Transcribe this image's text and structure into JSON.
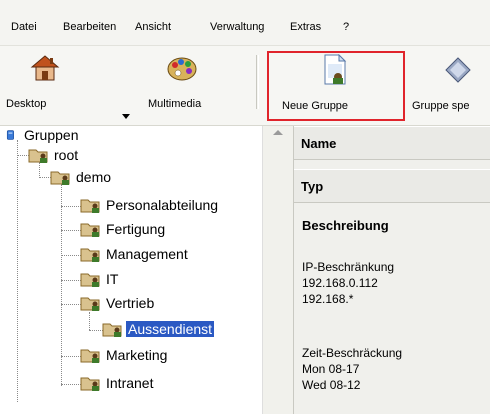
{
  "menu": {
    "items": [
      "Datei",
      "Bearbeiten",
      "Ansicht",
      "Verwaltung",
      "Extras",
      "?"
    ]
  },
  "toolbar": {
    "desktop_label": "Desktop",
    "multimedia_label": "Multimedia",
    "new_group_label": "Neue Gruppe",
    "save_group_label": "Gruppe spe"
  },
  "tree": {
    "root_label": "Gruppen",
    "nodes": [
      {
        "label": "root"
      },
      {
        "label": "demo"
      },
      {
        "label": "Personalabteilung"
      },
      {
        "label": "Fertigung"
      },
      {
        "label": "Management"
      },
      {
        "label": "IT"
      },
      {
        "label": "Vertrieb"
      },
      {
        "label": "Aussendienst"
      },
      {
        "label": "Marketing"
      },
      {
        "label": "Intranet"
      }
    ],
    "selected": "Aussendienst"
  },
  "properties": {
    "name_header": "Name",
    "type_header": "Typ",
    "description_header": "Beschreibung",
    "ip_title": "IP-Beschränkung",
    "ip_values": [
      "192.168.0.112",
      "192.168.*"
    ],
    "time_title": "Zeit-Beschräckung",
    "time_values": [
      "Mon 08-17",
      "Wed 08-12"
    ]
  },
  "colors": {
    "highlight_border": "#e0242b",
    "selection": "#2b59c3"
  }
}
